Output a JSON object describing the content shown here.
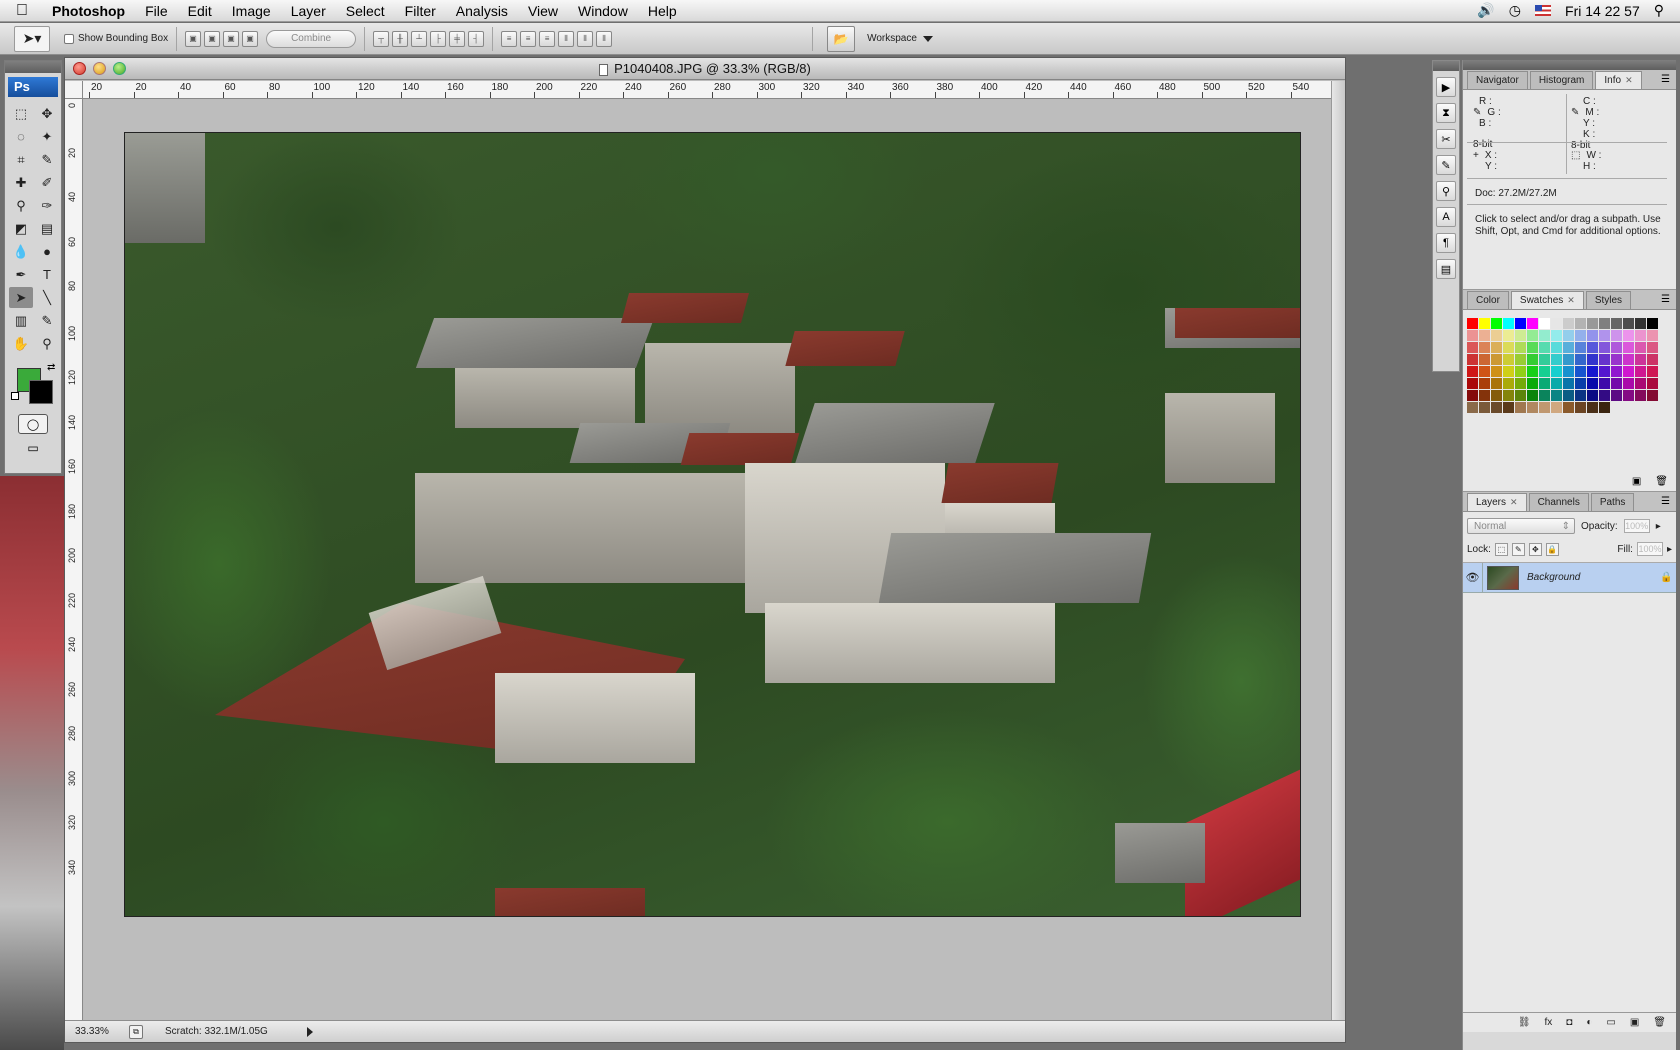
{
  "menubar": {
    "app": "Photoshop",
    "items": [
      "File",
      "Edit",
      "Image",
      "Layer",
      "Select",
      "Filter",
      "Analysis",
      "View",
      "Window",
      "Help"
    ],
    "clock": "Fri 14 22 57",
    "icons": [
      "volume-icon",
      "time-machine-icon",
      "flag-icon",
      "spotlight-icon"
    ]
  },
  "options": {
    "show_bounding_box": "Show Bounding Box",
    "combine": "Combine",
    "workspace": "Workspace"
  },
  "document": {
    "title": "P1040408.JPG @ 33.3% (RGB/8)",
    "ruler_top": [
      "20",
      "20",
      "40",
      "60",
      "80",
      "100",
      "120",
      "140",
      "160",
      "180",
      "200",
      "220",
      "240",
      "260",
      "280",
      "300",
      "320",
      "340",
      "360",
      "380",
      "400",
      "420",
      "440",
      "460",
      "480",
      "500",
      "520",
      "540"
    ],
    "ruler_left": [
      "0",
      "20",
      "40",
      "60",
      "80",
      "100",
      "120",
      "140",
      "160",
      "180",
      "200",
      "220",
      "240",
      "260",
      "280",
      "300",
      "320",
      "340"
    ],
    "zoom": "33.33%",
    "scratch": "Scratch: 332.1M/1.05G"
  },
  "tools": {
    "logo": "Ps",
    "fg_color": "#3aaa3a",
    "bg_color": "#000000"
  },
  "info_panel": {
    "tabs": [
      "Navigator",
      "Histogram",
      "Info"
    ],
    "rgb": [
      "R :",
      "G :",
      "B :"
    ],
    "cmyk": [
      "C :",
      "M :",
      "Y :",
      "K :"
    ],
    "bitdepth_left": "8-bit",
    "bitdepth_right": "8-bit",
    "xy": [
      "X :",
      "Y :"
    ],
    "wh": [
      "W :",
      "H :"
    ],
    "doc": "Doc: 27.2M/27.2M",
    "help": "Click to select and/or drag a subpath.  Use Shift, Opt, and Cmd for additional options."
  },
  "swatch_panel": {
    "tabs": [
      "Color",
      "Swatches",
      "Styles"
    ]
  },
  "layers_panel": {
    "tabs": [
      "Layers",
      "Channels",
      "Paths"
    ],
    "blend_mode": "Normal",
    "opacity_label": "Opacity:",
    "opacity_value": "100%",
    "lock_label": "Lock:",
    "fill_label": "Fill:",
    "fill_value": "100%",
    "layers": [
      {
        "name": "Background"
      }
    ]
  }
}
